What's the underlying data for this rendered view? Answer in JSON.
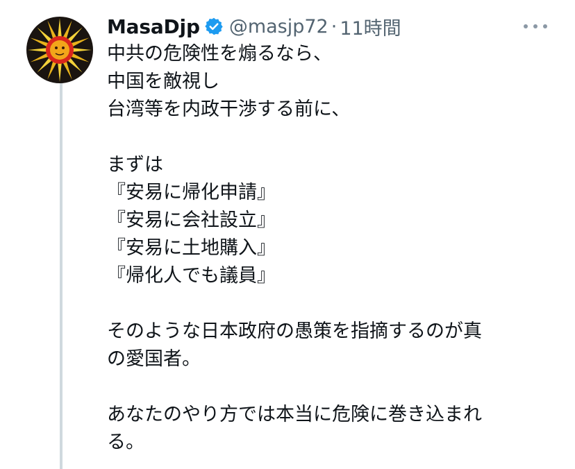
{
  "author": {
    "display_name": "MasaDjp",
    "handle": "@masjp72",
    "separator": "·",
    "time": "11時間",
    "avatar_icon": "sun-face-avatar",
    "verified_icon": "verified-badge-icon",
    "verified_color": "#1d9bf0"
  },
  "menu": {
    "icon": "more-options-icon"
  },
  "tweet": {
    "lines": [
      "中共の危険性を煽るなら、",
      "中国を敵視し",
      "台湾等を内政干渉する前に、",
      "",
      "まずは",
      "『安易に帰化申請』",
      "『安易に会社設立』",
      "『安易に土地購入』",
      "『帰化人でも議員』",
      "",
      "そのような日本政府の愚策を指摘するのが真",
      "の愛国者。",
      "",
      "あなたのやり方では本当に危険に巻き込まれ",
      "る。"
    ]
  },
  "colors": {
    "text": "#0f1419",
    "secondary": "#536471",
    "thread_line": "#cfd9de"
  }
}
